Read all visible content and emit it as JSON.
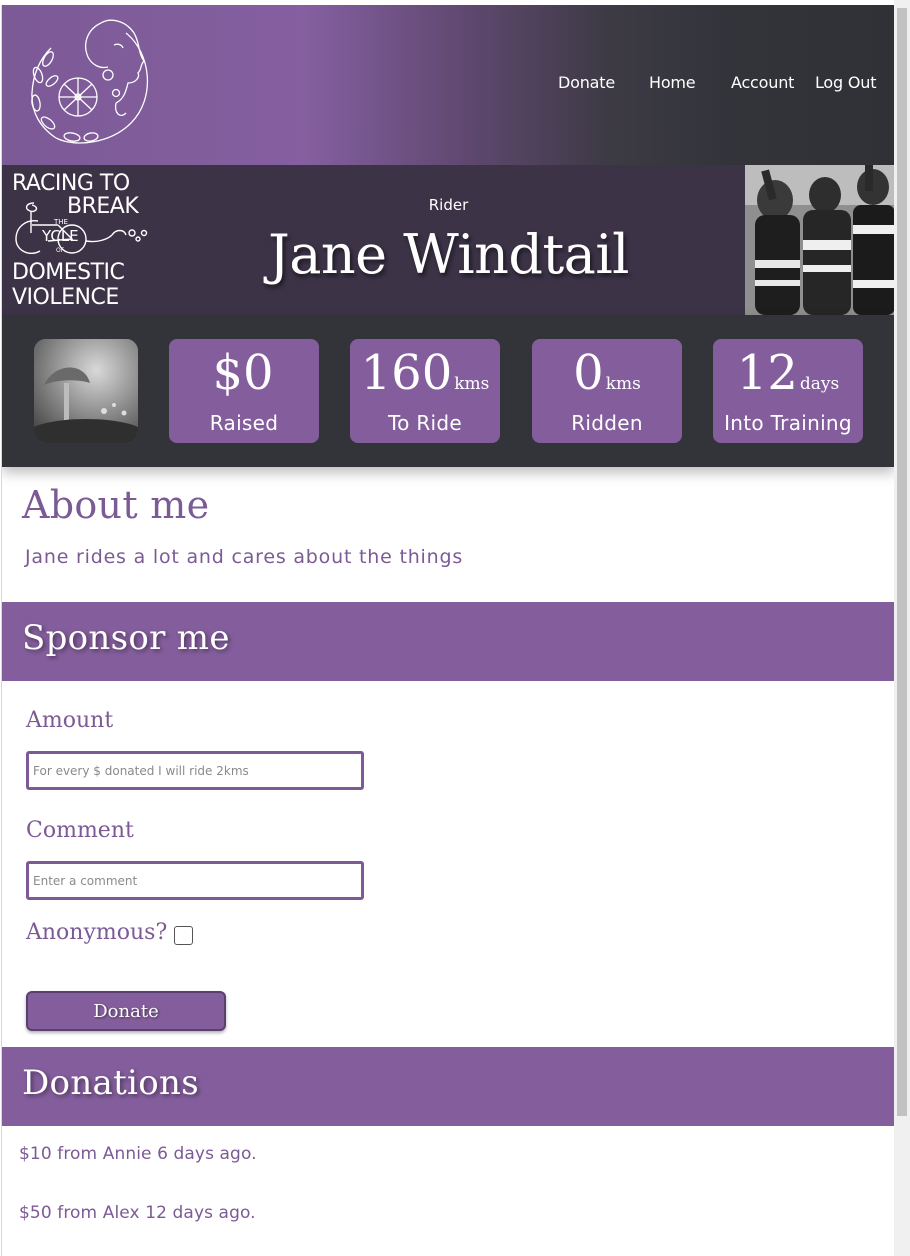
{
  "nav": {
    "items": [
      {
        "label": "Donate"
      },
      {
        "label": "Home"
      },
      {
        "label": "Account"
      },
      {
        "label": "Log Out"
      }
    ]
  },
  "brand": {
    "logo_icon": "woman-bicycle-flowers-logo",
    "line1": "RACING TO",
    "line2": "BREAK",
    "line3": "DOMESTIC",
    "line4": "VIOLENCE",
    "small_the": "THE",
    "small_ycle": "YCLE",
    "small_of": "OF"
  },
  "rider": {
    "label": "Rider",
    "name": "Jane Windtail"
  },
  "stats": [
    {
      "value": "$0",
      "unit": "",
      "label": "Raised"
    },
    {
      "value": "160",
      "unit": "kms",
      "label": "To Ride"
    },
    {
      "value": "0",
      "unit": "kms",
      "label": "Ridden"
    },
    {
      "value": "12",
      "unit": "days",
      "label": "Into Training"
    }
  ],
  "about": {
    "title": "About me",
    "text": "Jane rides a lot and cares about the things"
  },
  "sponsor": {
    "title": "Sponsor me",
    "amount_label": "Amount",
    "amount_placeholder": "For every $ donated I will ride 2kms",
    "comment_label": "Comment",
    "comment_placeholder": "Enter a comment",
    "anonymous_label": "Anonymous?",
    "donate_button": "Donate"
  },
  "donations": {
    "title": "Donations",
    "items": [
      "$10 from Annie 6 days ago.",
      "$50 from Alex 12 days ago."
    ]
  },
  "colors": {
    "accent": "#845e9c",
    "dark": "#323439",
    "band": "#3c3347"
  }
}
